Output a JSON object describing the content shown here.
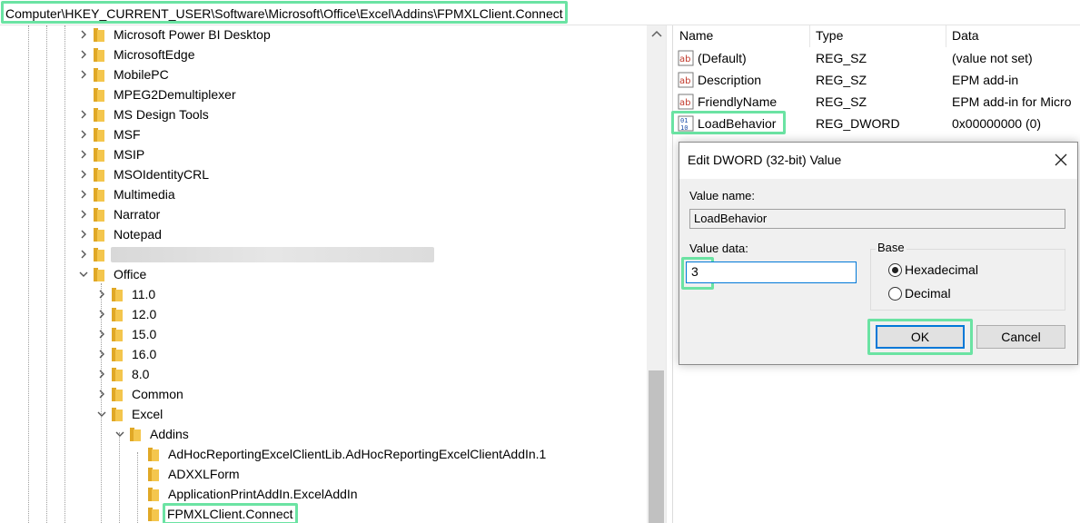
{
  "address_bar": {
    "path": "Computer\\HKEY_CURRENT_USER\\Software\\Microsoft\\Office\\Excel\\Addins\\FPMXLClient.Connect"
  },
  "tree": {
    "items": [
      {
        "label": "Microsoft Power BI Desktop",
        "expander": "collapsed"
      },
      {
        "label": "MicrosoftEdge",
        "expander": "collapsed"
      },
      {
        "label": "MobilePC",
        "expander": "collapsed"
      },
      {
        "label": "MPEG2Demultiplexer",
        "expander": "none"
      },
      {
        "label": "MS Design Tools",
        "expander": "collapsed"
      },
      {
        "label": "MSF",
        "expander": "collapsed"
      },
      {
        "label": "MSIP",
        "expander": "collapsed"
      },
      {
        "label": "MSOIdentityCRL",
        "expander": "collapsed"
      },
      {
        "label": "Multimedia",
        "expander": "collapsed"
      },
      {
        "label": "Narrator",
        "expander": "collapsed"
      },
      {
        "label": "Notepad",
        "expander": "collapsed"
      },
      {
        "label": "",
        "expander": "collapsed"
      },
      {
        "label": "Office",
        "expander": "expanded"
      },
      {
        "label": "11.0",
        "expander": "collapsed"
      },
      {
        "label": "12.0",
        "expander": "collapsed"
      },
      {
        "label": "15.0",
        "expander": "collapsed"
      },
      {
        "label": "16.0",
        "expander": "collapsed"
      },
      {
        "label": "8.0",
        "expander": "collapsed"
      },
      {
        "label": "Common",
        "expander": "collapsed"
      },
      {
        "label": "Excel",
        "expander": "expanded"
      },
      {
        "label": "Addins",
        "expander": "expanded"
      },
      {
        "label": "AdHocReportingExcelClientLib.AdHocReportingExcelClientAddIn.1",
        "expander": "none"
      },
      {
        "label": "ADXXLForm",
        "expander": "none"
      },
      {
        "label": "ApplicationPrintAddIn.ExcelAddIn",
        "expander": "none"
      },
      {
        "label": "FPMXLClient.Connect",
        "expander": "none"
      }
    ]
  },
  "values_list": {
    "headers": {
      "name": "Name",
      "type": "Type",
      "data": "Data"
    },
    "rows": [
      {
        "name": "(Default)",
        "type": "REG_SZ",
        "data": "(value not set)",
        "icon": "string-value-icon"
      },
      {
        "name": "Description",
        "type": "REG_SZ",
        "data": "EPM add-in",
        "icon": "string-value-icon"
      },
      {
        "name": "FriendlyName",
        "type": "REG_SZ",
        "data": "EPM add-in for Micro",
        "icon": "string-value-icon"
      },
      {
        "name": "LoadBehavior",
        "type": "REG_DWORD",
        "data": "0x00000000 (0)",
        "icon": "binary-value-icon"
      }
    ]
  },
  "dialog": {
    "title": "Edit DWORD (32-bit) Value",
    "value_name_label": "Value name:",
    "value_name": "LoadBehavior",
    "value_data_label": "Value data:",
    "value_data": "3",
    "base_label": "Base",
    "hex_label": "Hexadecimal",
    "dec_label": "Decimal",
    "selected_base": "hexadecimal",
    "ok_label": "OK",
    "cancel_label": "Cancel"
  },
  "colors": {
    "highlight": "#6be3a3",
    "folder": "#f4c64d",
    "focus": "#0078d7"
  }
}
